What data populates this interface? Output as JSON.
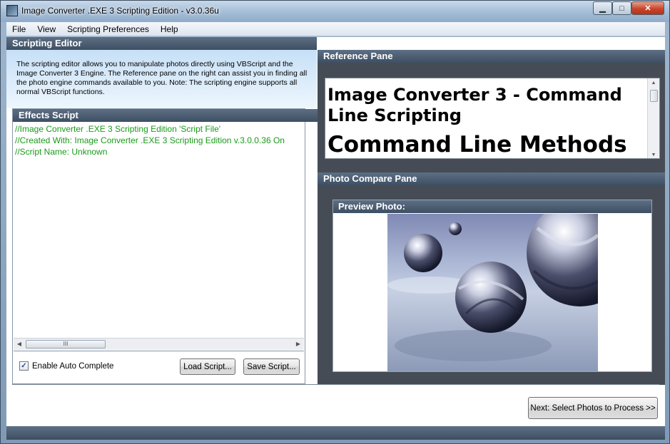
{
  "window": {
    "title": "Image Converter .EXE 3 Scripting Edition - v3.0.36u",
    "minimize_glyph": "▁",
    "maximize_glyph": "□",
    "close_glyph": "✕"
  },
  "menu": {
    "items": [
      "File",
      "View",
      "Scripting Preferences",
      "Help"
    ]
  },
  "scripting_editor": {
    "header": "Scripting Editor",
    "description": "The scripting editor allows you to manipulate photos directly using VBScript and the Image Converter 3 Engine. The Reference pane on the right can assist you in finding all the photo engine commands available to you. Note: The scripting engine supports all normal VBScript functions."
  },
  "effects_script": {
    "header": "Effects Script",
    "lines": [
      "//Image Converter .EXE 3 Scripting Edition 'Script File'",
      "//Created With: Image Converter .EXE 3 Scripting Edition v.3.0.0.36 On",
      "//Script Name: Unknown"
    ],
    "text_color": "#1a9a1a",
    "scroll_left_glyph": "◀",
    "scroll_right_glyph": "▶",
    "scroll_thumb_glyph": "III",
    "auto_complete_label": "Enable Auto Complete",
    "auto_complete_checked": true,
    "check_glyph": "✓",
    "load_button": "Load Script...",
    "save_button": "Save Script..."
  },
  "reference_pane": {
    "header": "Reference Pane",
    "title": "Image Converter 3 - Command Line Scripting",
    "subtitle": "Command Line Methods",
    "scroll_up_glyph": "▲",
    "scroll_down_glyph": "▼"
  },
  "photo_compare": {
    "header": "Photo Compare Pane",
    "preview_header": "Preview Photo:"
  },
  "footer": {
    "next_button": "Next: Select Photos to Process >>"
  },
  "colors": {
    "header_bg": "#3e4f63",
    "pane_bg": "#464c55",
    "intro_bg": "#c6e0f7"
  },
  "icons": {
    "app": "app-icon",
    "minimize": "minimize-icon",
    "maximize": "maximize-icon",
    "close": "close-icon"
  }
}
